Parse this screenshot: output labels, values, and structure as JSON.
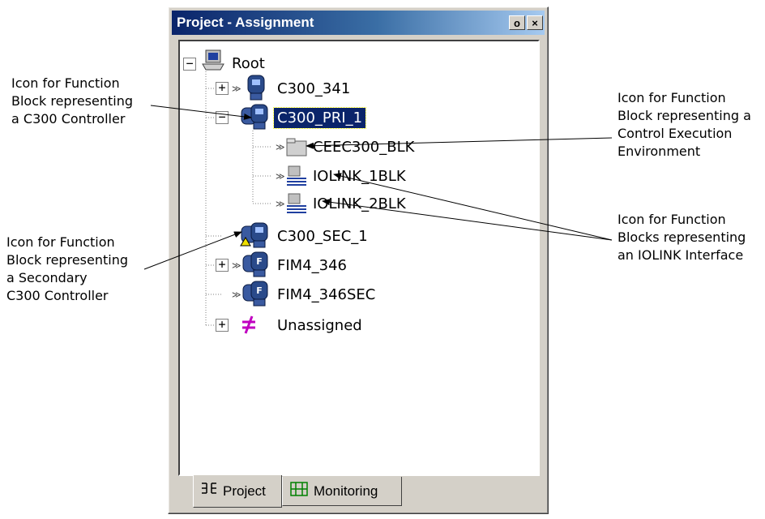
{
  "panel": {
    "title": "Project - Assignment",
    "title_buttons": [
      "o",
      "×"
    ]
  },
  "tree": {
    "root": "Root",
    "c300_341": "C300_341",
    "c300_pri": "C300_PRI_1",
    "ceec": "CEEC300_BLK",
    "iolink1": "IOLINK_1BLK",
    "iolink2": "IOLINK_2BLK",
    "c300_sec": "C300_SEC_1",
    "fim4": "FIM4_346",
    "fim4sec": "FIM4_346SEC",
    "unassigned": "Unassigned"
  },
  "tabs": {
    "project": "Project",
    "monitoring": "Monitoring"
  },
  "callouts": {
    "c300": "Icon for Function\nBlock representing\na C300 Controller",
    "cee": "Icon for Function\nBlock representing a\nControl Execution\nEnvironment",
    "iolink": "Icon for Function\nBlocks representing\nan IOLINK Interface",
    "secondary": "Icon for Function\nBlock representing\na Secondary\nC300 Controller"
  },
  "colors": {
    "selection": "#0a246a",
    "title_start": "#0a246a",
    "title_end": "#a6caf0",
    "controller_icon": "#1f3a7a",
    "unassigned_icon": "#c000c0",
    "warning_icon": "#f0e000"
  }
}
